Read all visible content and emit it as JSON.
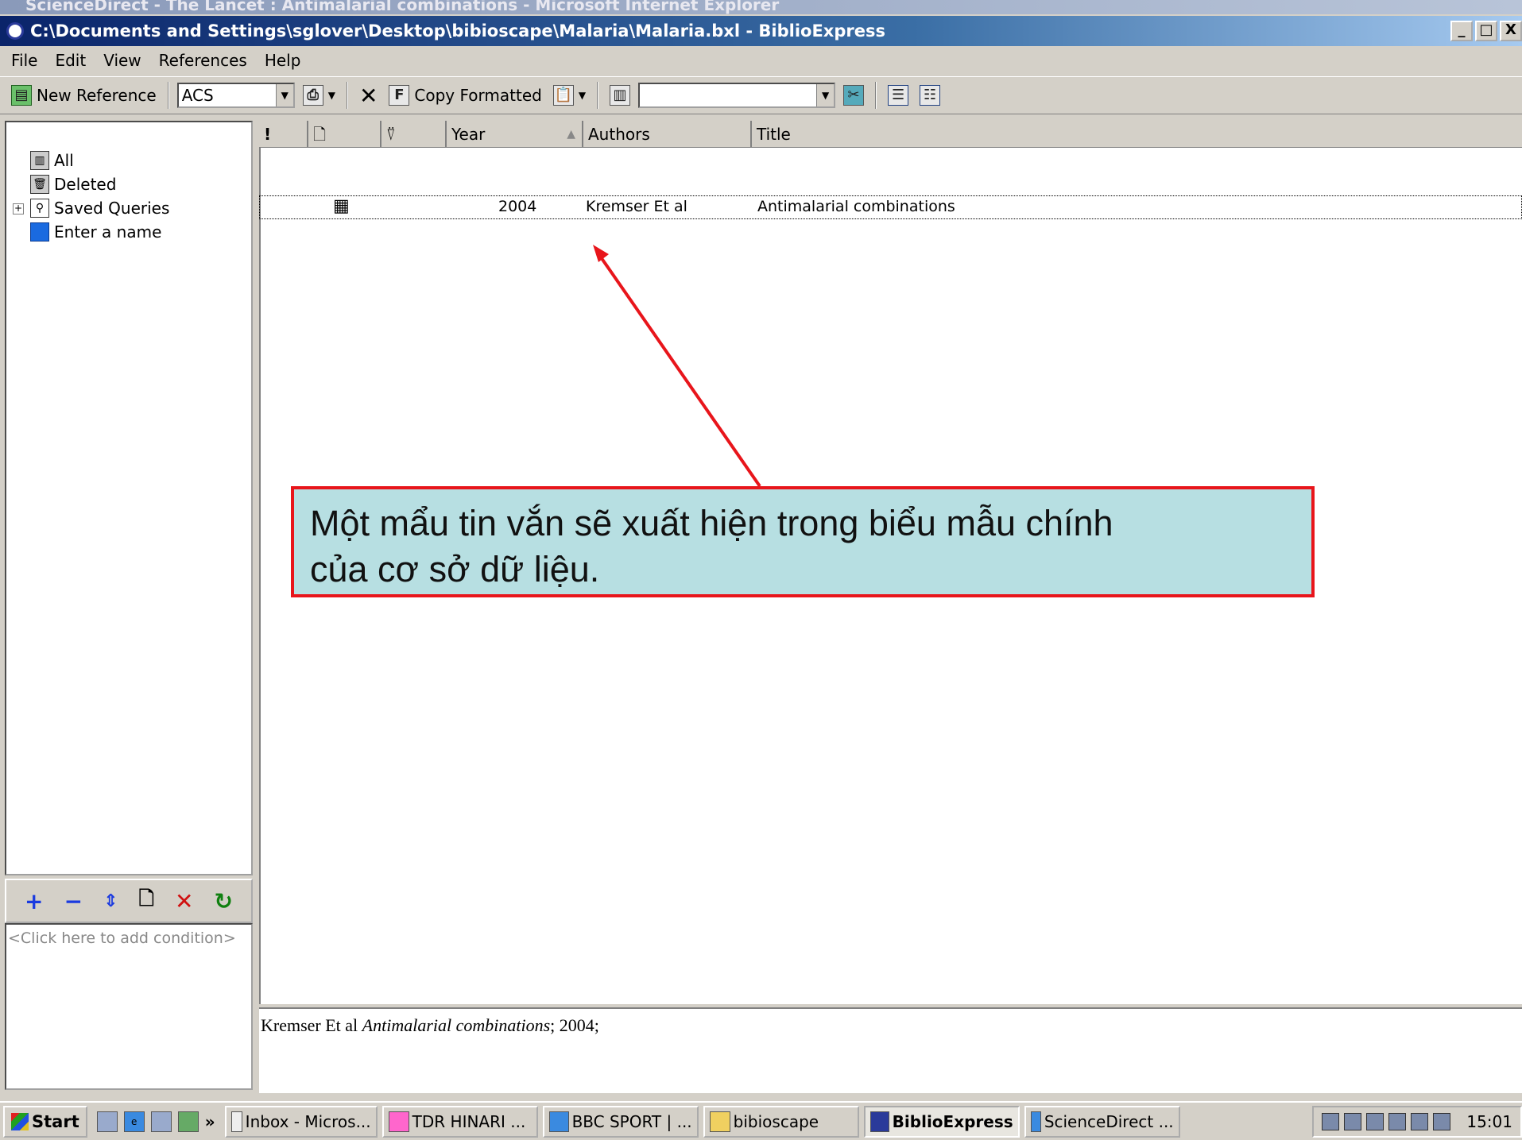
{
  "ie_window": {
    "title": "ScienceDirect - The Lancet : Antimalarial combinations - Microsoft Internet Explorer"
  },
  "window": {
    "title": "C:\\Documents and Settings\\sglover\\Desktop\\bibioscape\\Malaria\\Malaria.bxl - BiblioExpress",
    "buttons": {
      "minimize": "_",
      "maximize": "□",
      "close": "X"
    }
  },
  "menu": [
    "File",
    "Edit",
    "View",
    "References",
    "Help"
  ],
  "toolbar": {
    "new_reference": "New Reference",
    "style_value": "ACS",
    "copy_formatted": "Copy Formatted",
    "search_value": ""
  },
  "tree": {
    "items": [
      "All",
      "Deleted",
      "Saved Queries",
      "Enter a name"
    ]
  },
  "conditions": {
    "placeholder": "<Click here to add condition>"
  },
  "list": {
    "columns": {
      "flag": "!",
      "year": "Year",
      "authors": "Authors",
      "title": "Title"
    },
    "rows": [
      {
        "year": "2004",
        "authors": "Kremser Et al",
        "title": "Antimalarial combinations"
      }
    ]
  },
  "preview": {
    "authors": "Kremser Et al ",
    "title": "Antimalarial combinations",
    "tail": "; 2004;"
  },
  "callout": {
    "line1": "Một mẩu tin vắn sẽ xuất hiện trong biểu mẫu chính",
    "line2": "của cơ sở dữ liệu."
  },
  "taskbar": {
    "start": "Start",
    "tasks": [
      "Inbox - Micros...",
      "TDR HINARI ...",
      "BBC SPORT | ...",
      "bibioscape",
      "BiblioExpress",
      "ScienceDirect ..."
    ],
    "clock": "15:01"
  },
  "colors": {
    "callout_bg": "#b7dfe2",
    "callout_border": "#e8151b",
    "arrow": "#e8151b",
    "titlebar": "#0a246a"
  }
}
